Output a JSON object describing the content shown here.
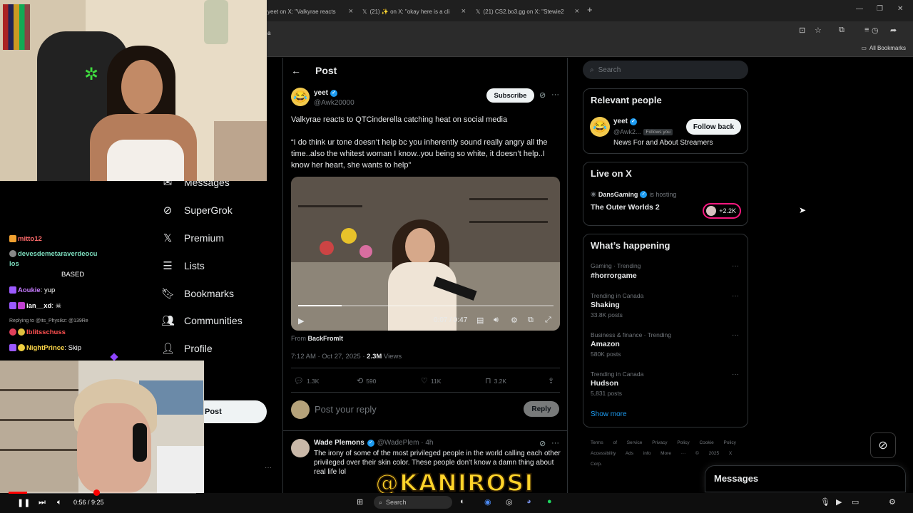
{
  "browser": {
    "tabs": [
      {
        "label": "yeet on X: \"Valkyrae reacts"
      },
      {
        "label": "(21) ✨ on X: \"okay here is a cli"
      },
      {
        "label": "(21) CS2.bo3.gg on X: \"Stewie2"
      }
    ],
    "new_tab": "+",
    "address_fragment": "a",
    "bookmarks_label": "All Bookmarks"
  },
  "nav": {
    "items": [
      {
        "label": "Messages",
        "icon": "envelope-icon"
      },
      {
        "label": "SuperGrok",
        "icon": "grok-icon"
      },
      {
        "label": "Premium",
        "icon": "x-logo-icon"
      },
      {
        "label": "Lists",
        "icon": "list-icon"
      },
      {
        "label": "Bookmarks",
        "icon": "bookmark-icon"
      },
      {
        "label": "Communities",
        "icon": "communities-icon"
      },
      {
        "label": "Profile",
        "icon": "profile-icon"
      }
    ],
    "post_button": "Post",
    "more_dots": "···"
  },
  "post": {
    "header_title": "Post",
    "author_name": "yeet",
    "author_handle": "@Awk20000",
    "subscribe_label": "Subscribe",
    "text_line1": "Valkyrae reacts to QTCinderella catching heat on social media",
    "text_quote": "“I do think ur tone doesn’t help bc you inherently sound really angry all the time..also the whitest woman I know..you being so white, it doesn’t help..I know her heart, she wants to help”",
    "video": {
      "time": "0:07 / 0:47",
      "progress": 0.17
    },
    "from_label": "From",
    "from_source": "BackFromIt",
    "timestamp": "7:12 AM · Oct 27, 2025 · ",
    "views": "2.3M",
    "views_label": " Views",
    "stats": {
      "replies": "1.3K",
      "reposts": "590",
      "likes": "11K",
      "bookmarks": "3.2K"
    },
    "reply_placeholder": "Post your reply",
    "reply_button": "Reply"
  },
  "comment": {
    "name": "Wade Plemons",
    "handle": "@WadePlem · 4h",
    "text": "The irony of some of the most privileged people in the world calling each other privileged over their skin color. These people don't know a damn thing about real life lol"
  },
  "sidebar": {
    "search_placeholder": "Search",
    "relevant_title": "Relevant people",
    "relevant_person": {
      "name": "yeet",
      "handle": "@Awk2...",
      "follows_you": "Follows you",
      "bio": "News For and About Streamers",
      "button": "Follow back"
    },
    "live_title": "Live on X",
    "live": {
      "host": "DansGaming",
      "hosting_label": "is hosting",
      "title": "The Outer Worlds 2",
      "count": "+2.2K"
    },
    "happening_title": "What’s happening",
    "trends": [
      {
        "category": "Gaming · Trending",
        "name": "#horrorgame",
        "count": ""
      },
      {
        "category": "Trending in Canada",
        "name": "Shaking",
        "count": "33.8K posts"
      },
      {
        "category": "Business & finance · Trending",
        "name": "Amazon",
        "count": "580K posts"
      },
      {
        "category": "Trending in Canada",
        "name": "Hudson",
        "count": "5,831 posts"
      }
    ],
    "show_more": "Show more",
    "footer": "Terms of Service Privacy Policy Cookie Policy Accessibility Ads info More ··· © 2025 X Corp."
  },
  "messages_label": "Messages",
  "chat": {
    "lines": [
      {
        "user": "mitto12",
        "text": "",
        "color": "#ff6b6b"
      },
      {
        "user": "devesdemetaraverdeocu",
        "text": "",
        "color": "#7ee0c0"
      },
      {
        "user": "los",
        "text": "",
        "color": "#7ee0c0"
      },
      {
        "user": "",
        "text": "BASED",
        "color": "#ffffff"
      },
      {
        "user": "Aoukie",
        "text": ": yup",
        "color": "#c67bff"
      },
      {
        "user": "ian__xd",
        "text": ":",
        "color": "#ffffff"
      },
      {
        "user": "Replying to @its_Physikz: @139Re",
        "text": "",
        "color": "#aaaaaa"
      },
      {
        "user": "Iblitsschuss",
        "text": "",
        "color": "#ff5050"
      },
      {
        "user": "NightPrince",
        "text": ": Skip",
        "color": "#ffd84a"
      }
    ]
  },
  "player": {
    "time": "0:56 / 9:25",
    "progress": 0.1
  }
}
